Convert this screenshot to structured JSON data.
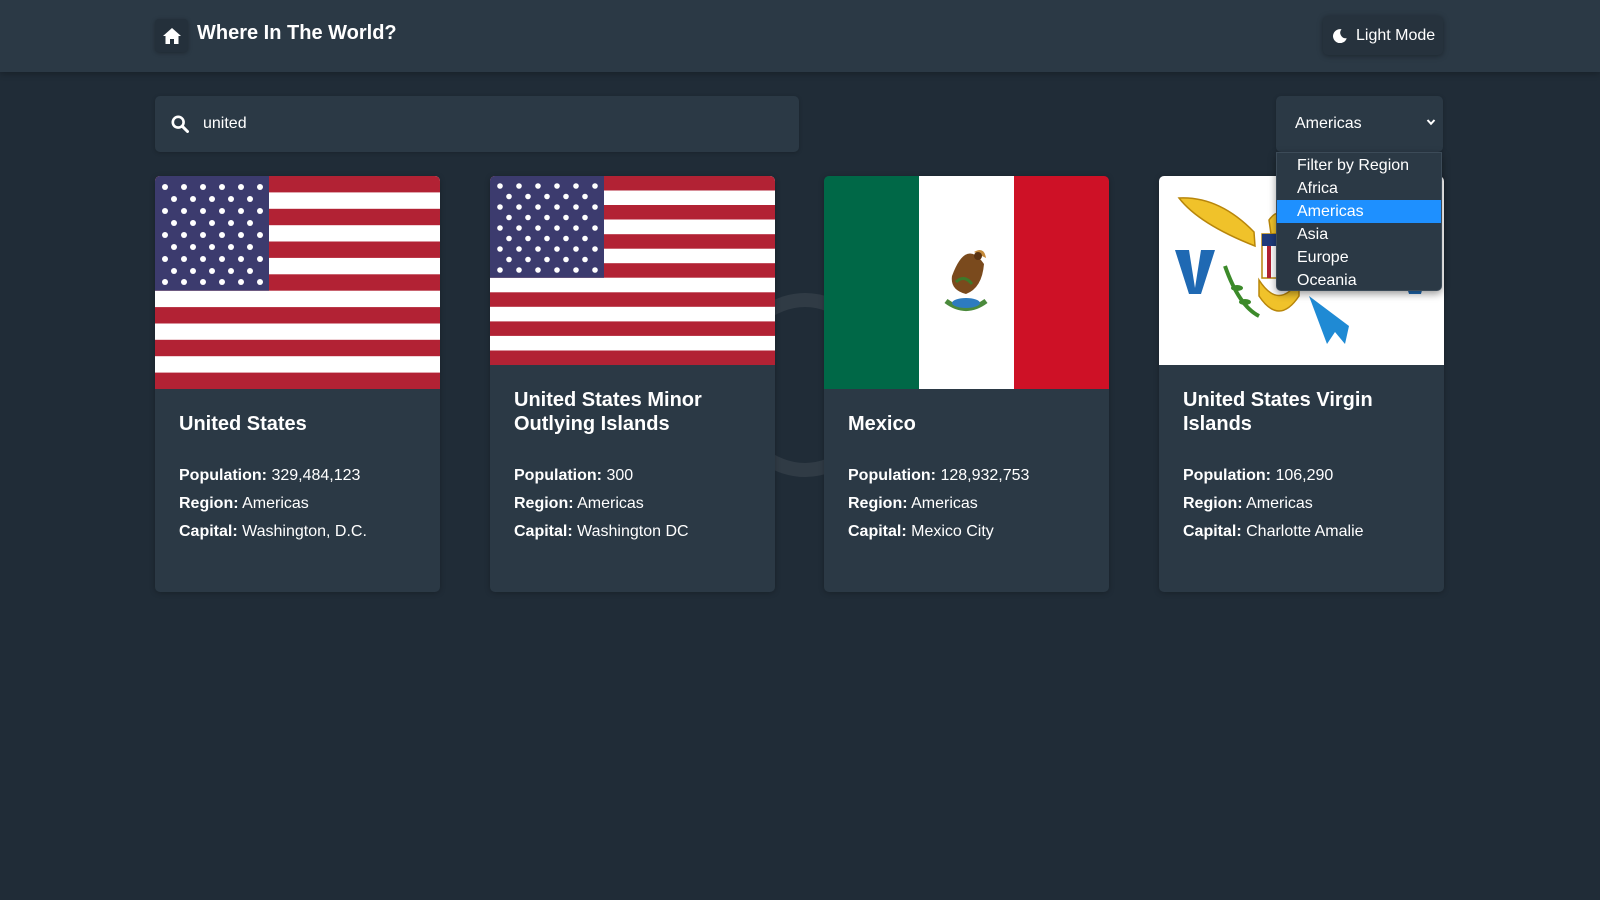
{
  "header": {
    "title": "Where In The World?",
    "mode_label": "Light Mode"
  },
  "search": {
    "value": "united",
    "icon": "search-icon"
  },
  "filter": {
    "selected": "Americas",
    "options": [
      "Filter by Region",
      "Africa",
      "Americas",
      "Asia",
      "Europe",
      "Oceania"
    ]
  },
  "labels": {
    "population": "Population:",
    "region": "Region:",
    "capital": "Capital:"
  },
  "countries": [
    {
      "name": "United States",
      "population": "329,484,123",
      "region": "Americas",
      "capital": "Washington, D.C.",
      "flag": "us-flag"
    },
    {
      "name": "United States Minor Outlying Islands",
      "population": "300",
      "region": "Americas",
      "capital": "Washington DC",
      "flag": "us-flag"
    },
    {
      "name": "Mexico",
      "population": "128,932,753",
      "region": "Americas",
      "capital": "Mexico City",
      "flag": "mexico-flag"
    },
    {
      "name": "United States Virgin Islands",
      "population": "106,290",
      "region": "Americas",
      "capital": "Charlotte Amalie",
      "flag": "usvi-flag"
    }
  ],
  "colors": {
    "background": "#202c37",
    "element": "#2b3945",
    "text": "#ffffff",
    "selected_option": "#1e90ff"
  }
}
